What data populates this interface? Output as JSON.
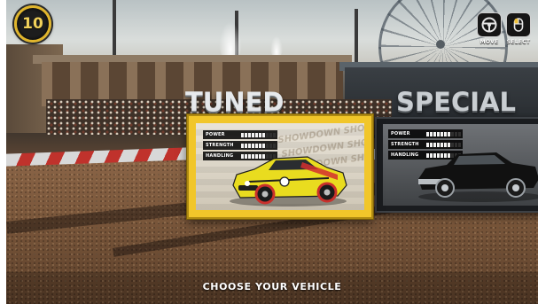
{
  "hud": {
    "level_number": "10",
    "controls": [
      {
        "label": "MOVE",
        "icon": "steering-wheel-icon"
      },
      {
        "label": "SELECT",
        "icon": "mouse-icon"
      }
    ]
  },
  "vehicles": [
    {
      "category": "TUNED",
      "selected": true,
      "card_color": "#f1c62a",
      "stats": [
        {
          "name": "POWER",
          "level": 7,
          "max": 10
        },
        {
          "name": "STRENGTH",
          "level": 7,
          "max": 10
        },
        {
          "name": "HANDLING",
          "level": 7,
          "max": 10
        }
      ]
    },
    {
      "category": "SPECIAL",
      "selected": false,
      "card_color": "#1a1c1f",
      "stats": [
        {
          "name": "POWER",
          "level": 7,
          "max": 10
        },
        {
          "name": "STRENGTH",
          "level": 7,
          "max": 10
        },
        {
          "name": "HANDLING",
          "level": 7,
          "max": 10
        }
      ]
    }
  ],
  "footer": {
    "prompt": "CHOOSE YOUR VEHICLE"
  }
}
